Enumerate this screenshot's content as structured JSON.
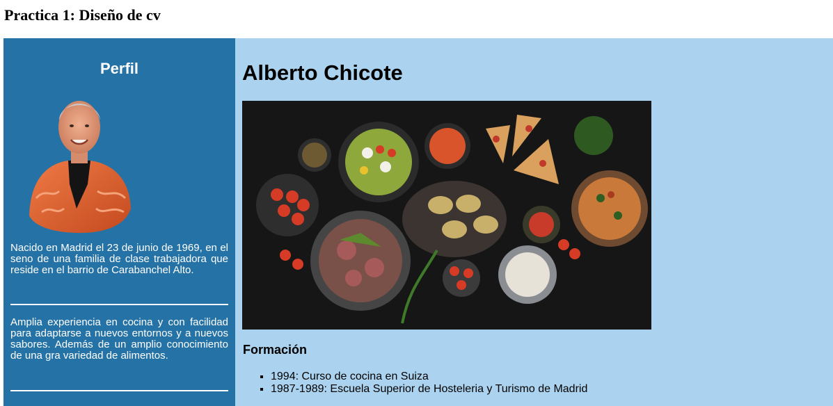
{
  "page": {
    "title": "Practica 1: Diseño de cv"
  },
  "sidebar": {
    "heading": "Perfil",
    "paragraphs": [
      "Nacido en Madrid el 23 de junio de 1969, en el seno de una familia de clase trabajadora que reside en el barrio de Carabanchel Alto.",
      "Amplia experiencia en cocina y con facilidad para adaptarse a nuevos entornos y a nuevos sabores. Además de un amplio conocimiento de una gra variedad de alimentos."
    ]
  },
  "main": {
    "name": "Alberto Chicote",
    "section_heading": "Formación",
    "education": [
      "1994: Curso de cocina en Suiza",
      "1987-1989: Escuela Superior de Hosteleria y Turismo de Madrid"
    ]
  },
  "colors": {
    "sidebar_bg": "#2572a6",
    "main_bg": "#abd3ef",
    "text_light": "#ffffff",
    "text_dark": "#000000"
  }
}
